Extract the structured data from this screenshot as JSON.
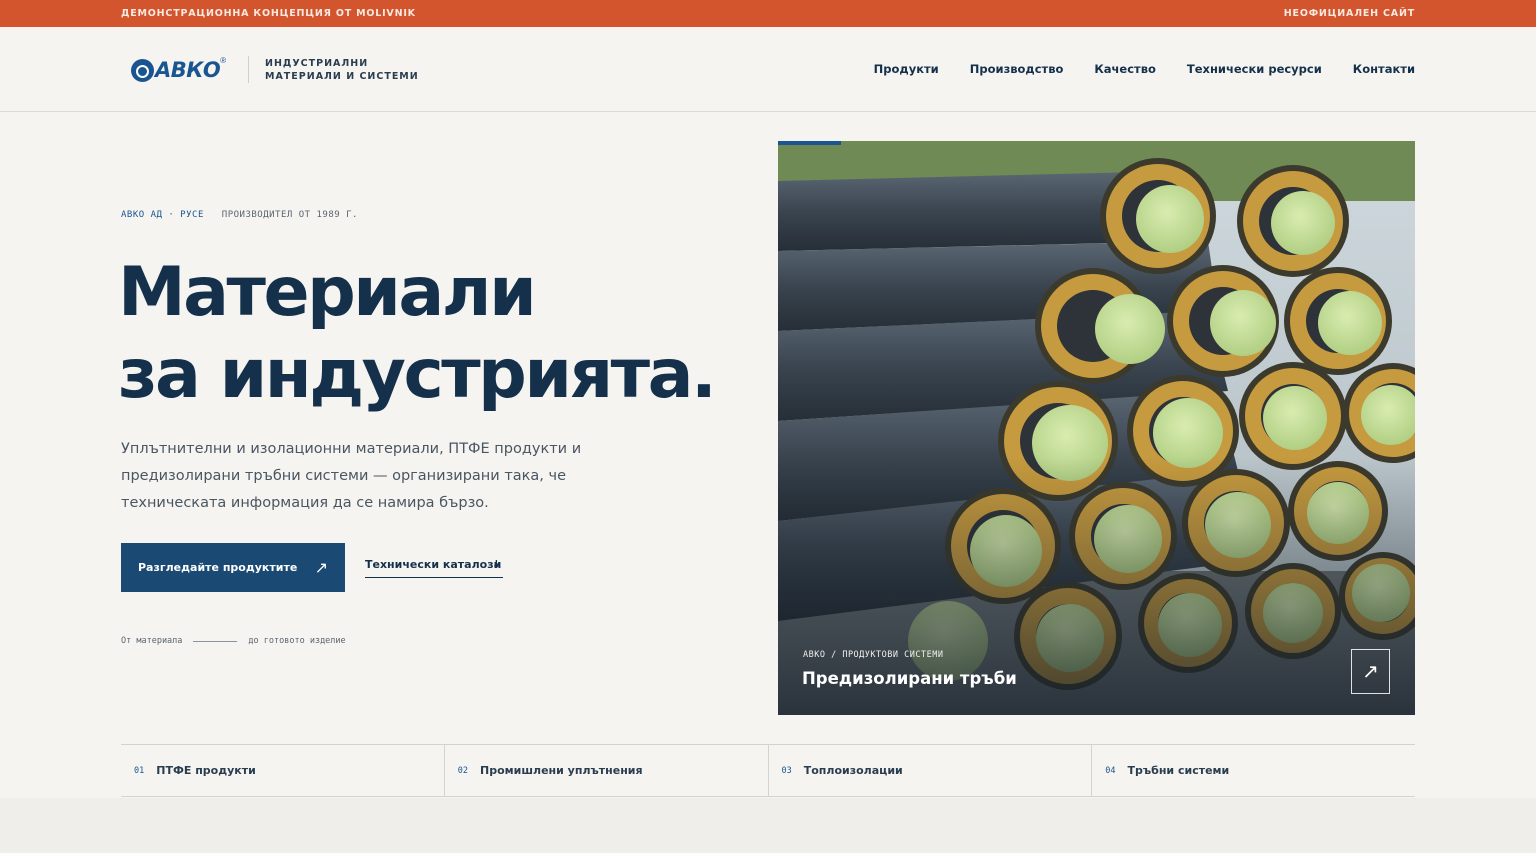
{
  "topbar": {
    "left_text": "Демонстрационна концепция от Molivnik",
    "right_text": "Неофициален сайт"
  },
  "brand": {
    "logo_text": "АВКО",
    "logo_reg": "®",
    "tagline_line1": "Индустриални",
    "tagline_line2": "материали и системи"
  },
  "nav": {
    "items": [
      "Продукти",
      "Производство",
      "Качество",
      "Технически ресурси",
      "Контакти"
    ]
  },
  "hero": {
    "eyebrow_company": "АВКО АД · РУСЕ",
    "eyebrow_since": "ПРОИЗВОДИТЕЛ ОТ 1989 Г.",
    "title_line1": "Материали",
    "title_line2": "за индустрията.",
    "description": "Уплътнителни и изолационни материали, ПТФЕ продукти и предизолирани тръбни системи — организирани така, че техническата информация да се намира бързо.",
    "primary_button": "Разгледайте продуктите",
    "primary_button_icon": "arrow-up-right-icon",
    "secondary_link": "Технически каталози",
    "secondary_link_icon": "arrow-down-icon",
    "flow_from": "От материала",
    "flow_to": "до готовото изделие"
  },
  "feature_image": {
    "kicker": "АВКО / ПРОДУКТОВИ СИСТЕМИ",
    "title": "Предизолирани тръби",
    "button_icon": "arrow-up-right-icon"
  },
  "categories": [
    {
      "num": "01",
      "label": "ПТФЕ продукти"
    },
    {
      "num": "02",
      "label": "Промишлени уплътнения"
    },
    {
      "num": "03",
      "label": "Топлоизолации"
    },
    {
      "num": "04",
      "label": "Тръбни системи"
    }
  ],
  "colors": {
    "accent": "#d2552e",
    "brand_blue": "#1a5592",
    "navy": "#15304a",
    "background": "#f5f4f1"
  }
}
